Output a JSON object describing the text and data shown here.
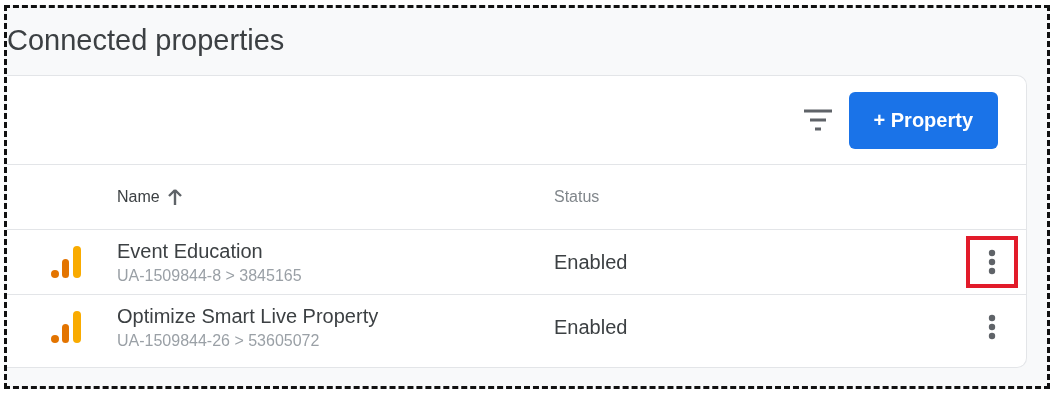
{
  "page": {
    "title": "Connected properties"
  },
  "toolbar": {
    "add_button": "+ Property"
  },
  "table": {
    "columns": [
      {
        "label": "Name",
        "sorted": true
      },
      {
        "label": "Status",
        "sorted": false
      }
    ],
    "rows": [
      {
        "name": "Event Education",
        "id": "UA-1509844-8 > 3845165",
        "status": "Enabled",
        "highlighted": true
      },
      {
        "name": "Optimize Smart Live Property",
        "id": "UA-1509844-26 > 53605072",
        "status": "Enabled",
        "highlighted": false
      }
    ]
  }
}
